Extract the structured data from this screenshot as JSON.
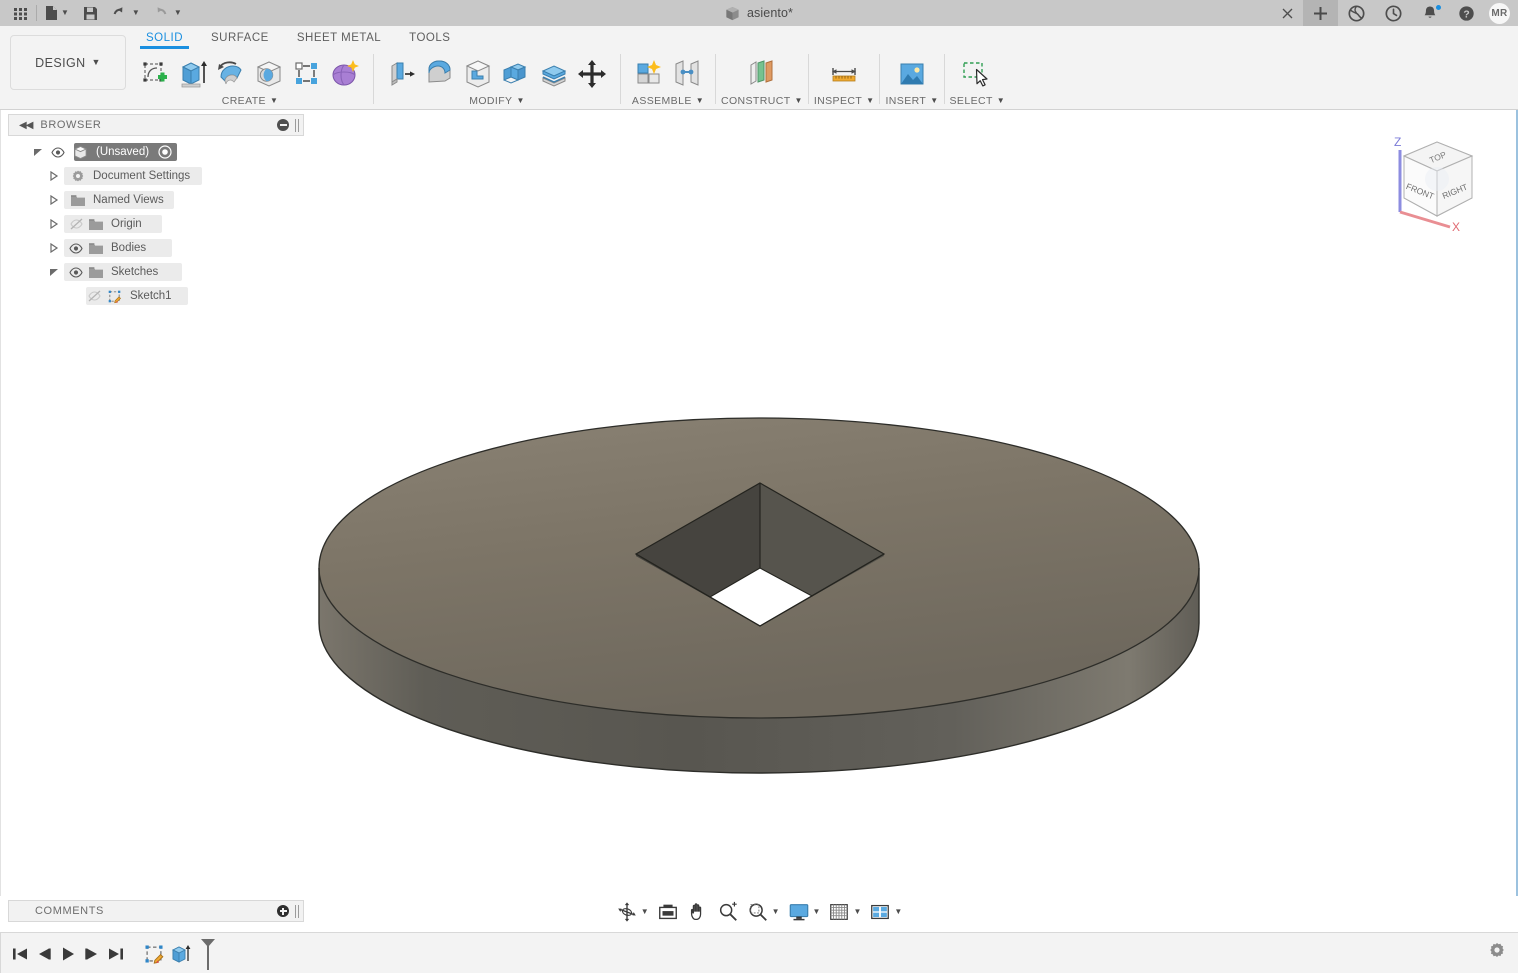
{
  "titlebar": {
    "doc_name": "asiento*",
    "left_buttons": [
      {
        "name": "app-grid-icon",
        "label": ""
      },
      {
        "name": "new-file-icon",
        "label": ""
      },
      {
        "name": "save-icon",
        "label": ""
      },
      {
        "name": "undo-icon",
        "label": ""
      },
      {
        "name": "redo-icon",
        "label": ""
      }
    ],
    "right_buttons": [
      {
        "name": "close-tab-icon",
        "label": "×"
      },
      {
        "name": "new-tab-icon",
        "label": "+"
      },
      {
        "name": "data-panel-icon",
        "label": ""
      },
      {
        "name": "job-status-icon",
        "label": ""
      },
      {
        "name": "notifications-icon",
        "label": ""
      },
      {
        "name": "help-icon",
        "label": "?"
      }
    ],
    "avatar_initials": "MR"
  },
  "ribbon": {
    "design_label": "DESIGN",
    "workspace_tabs": [
      {
        "label": "SOLID",
        "active": true
      },
      {
        "label": "SURFACE",
        "active": false
      },
      {
        "label": "SHEET METAL",
        "active": false
      },
      {
        "label": "TOOLS",
        "active": false
      }
    ],
    "groups": [
      {
        "label": "CREATE",
        "has_caret": true,
        "tools": [
          "create-sketch",
          "extrude",
          "revolve",
          "sphere",
          "pattern",
          "form"
        ]
      },
      {
        "label": "MODIFY",
        "has_caret": true,
        "tools": [
          "press-pull",
          "fillet",
          "shell",
          "combine",
          "offset-face",
          "move-copy"
        ]
      },
      {
        "label": "ASSEMBLE",
        "has_caret": true,
        "tools": [
          "new-component",
          "joint"
        ]
      },
      {
        "label": "CONSTRUCT",
        "has_caret": true,
        "tools": [
          "offset-plane"
        ]
      },
      {
        "label": "INSPECT",
        "has_caret": true,
        "tools": [
          "measure"
        ]
      },
      {
        "label": "INSERT",
        "has_caret": true,
        "tools": [
          "insert-image"
        ]
      },
      {
        "label": "SELECT",
        "has_caret": true,
        "tools": [
          "select-window"
        ]
      }
    ]
  },
  "browser": {
    "title": "BROWSER",
    "tree": [
      {
        "label": "(Unsaved)",
        "indent": 0,
        "arrow": "expanded",
        "eye": "visible",
        "icon": "component-icon",
        "root": true
      },
      {
        "label": "Document Settings",
        "indent": 1,
        "arrow": "collapsed",
        "eye": "none",
        "icon": "gear-icon",
        "root": false
      },
      {
        "label": "Named Views",
        "indent": 1,
        "arrow": "collapsed",
        "eye": "none",
        "icon": "folder-icon",
        "root": false
      },
      {
        "label": "Origin",
        "indent": 1,
        "arrow": "collapsed",
        "eye": "hidden",
        "icon": "folder-icon",
        "root": false
      },
      {
        "label": "Bodies",
        "indent": 1,
        "arrow": "collapsed",
        "eye": "visible",
        "icon": "folder-icon",
        "root": false
      },
      {
        "label": "Sketches",
        "indent": 1,
        "arrow": "expanded",
        "eye": "visible",
        "icon": "folder-icon",
        "root": false
      },
      {
        "label": "Sketch1",
        "indent": 2,
        "arrow": "none",
        "eye": "hidden",
        "icon": "sketch-icon",
        "root": false
      }
    ]
  },
  "canvas": {
    "background_color": "#ffffff",
    "model": {
      "name": "cylindrical-disc-with-square-hole",
      "top_face_color": "#7d7567",
      "side_face_light_color": "#6d6a61",
      "side_face_dark_color": "#53534c",
      "hole_wall_left_color": "#4a4843",
      "hole_wall_right_color": "#56544e",
      "edge_color": "#2b2b28",
      "hole_through_color": "#ffffff"
    },
    "viewcube": {
      "faces": [
        "TOP",
        "FRONT",
        "RIGHT"
      ],
      "axes": [
        {
          "label": "Z",
          "color": "#7b7bd8"
        },
        {
          "label": "X",
          "color": "#e06a72"
        }
      ]
    }
  },
  "comments": {
    "title": "COMMENTS"
  },
  "navbar": {
    "items": [
      {
        "name": "orbit-icon",
        "caret": true
      },
      {
        "name": "look-at-icon",
        "caret": false
      },
      {
        "name": "pan-icon",
        "caret": false
      },
      {
        "name": "zoom-icon",
        "caret": false
      },
      {
        "name": "zoom-window-icon",
        "caret": true
      },
      {
        "name": "display-settings-icon",
        "caret": true
      },
      {
        "name": "grid-snaps-icon",
        "caret": true
      },
      {
        "name": "viewports-icon",
        "caret": true
      }
    ]
  },
  "timeline": {
    "controls": [
      {
        "name": "go-to-beginning-button"
      },
      {
        "name": "step-back-button"
      },
      {
        "name": "play-button"
      },
      {
        "name": "step-forward-button"
      },
      {
        "name": "go-to-end-button"
      }
    ],
    "features": [
      {
        "name": "timeline-feature-sketch1",
        "label": "Sketch1"
      },
      {
        "name": "timeline-feature-extrude",
        "label": "Extrude"
      }
    ],
    "settings_icon": "gear-icon"
  }
}
